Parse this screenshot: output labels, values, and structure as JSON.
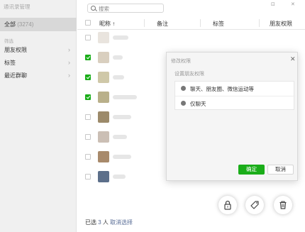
{
  "app": {
    "title": "通讯录管理"
  },
  "sidebar": {
    "all_label": "全部",
    "all_count": "(3274)",
    "filter_label": "筛选",
    "items": [
      {
        "label": "朋友权限"
      },
      {
        "label": "标签"
      },
      {
        "label": "最近群聊"
      }
    ]
  },
  "search": {
    "placeholder": "搜索"
  },
  "window_controls": {
    "pin": "⊡",
    "close": "✕"
  },
  "table": {
    "columns": [
      "昵称 ↑",
      "备注",
      "标签",
      "朋友权限"
    ],
    "rows": [
      {
        "checked": false,
        "avatar_color": "#e9e4de"
      },
      {
        "checked": true,
        "avatar_color": "#d9cfbf"
      },
      {
        "checked": true,
        "avatar_color": "#cfc8a8"
      },
      {
        "checked": true,
        "avatar_color": "#b9b08a"
      },
      {
        "checked": false,
        "avatar_color": "#9c8a6a"
      },
      {
        "checked": false,
        "avatar_color": "#cbbfb5"
      },
      {
        "checked": false,
        "avatar_color": "#a88a6b"
      },
      {
        "checked": false,
        "avatar_color": "#5c6f8a"
      },
      {
        "checked": false,
        "avatar_color": "#c9c3d0"
      }
    ]
  },
  "selection": {
    "prefix": "已选",
    "count": "3",
    "suffix": "人",
    "cancel_label": "取消选择"
  },
  "dialog": {
    "title": "修改权限",
    "close": "✕",
    "subtitle": "设置朋友权限",
    "options": [
      "聊天、朋友圈、微信运动等",
      "仅聊天"
    ],
    "ok_label": "确定",
    "cancel_label": "取消"
  },
  "colors": {
    "accent": "#1aad19",
    "link": "#576b95"
  }
}
